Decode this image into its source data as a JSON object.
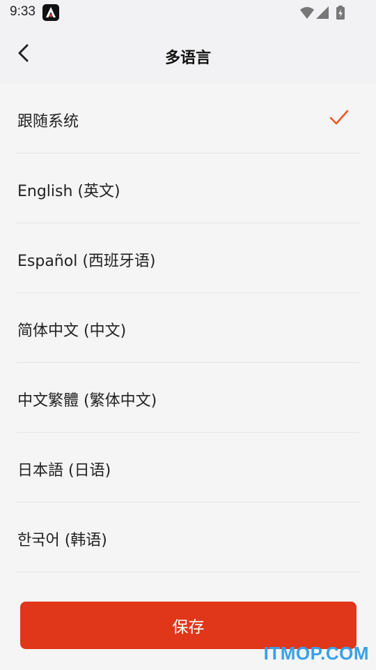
{
  "status_bar": {
    "time": "9:33",
    "icons": [
      "app-a-icon",
      "wifi-icon",
      "cell-signal-icon",
      "battery-charging-icon"
    ]
  },
  "header": {
    "title": "多语言",
    "back_icon": "chevron-left-icon"
  },
  "languages": [
    {
      "label": "跟随系统",
      "selected": true
    },
    {
      "label": "English (英文)",
      "selected": false
    },
    {
      "label": "Español (西班牙语)",
      "selected": false
    },
    {
      "label": "简体中文 (中文)",
      "selected": false
    },
    {
      "label": "中文繁體 (繁体中文)",
      "selected": false
    },
    {
      "label": "日本語 (日语)",
      "selected": false
    },
    {
      "label": "한국어 (韩语)",
      "selected": false
    }
  ],
  "save_label": "保存",
  "watermark": "ITMOP.COM",
  "colors": {
    "accent": "#e03619",
    "check": "#f0561f",
    "background": "#f5f5f5"
  }
}
